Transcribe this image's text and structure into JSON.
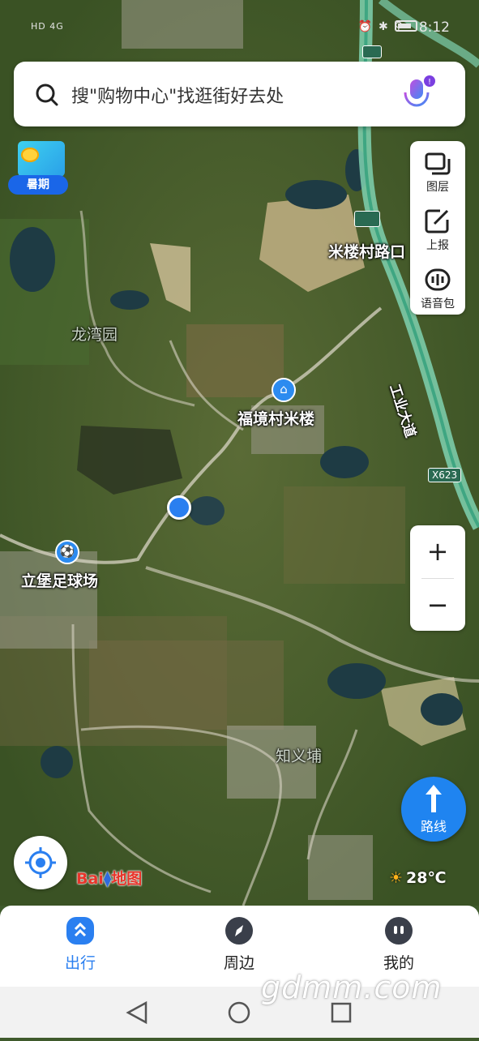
{
  "status_bar": {
    "network": "HD 4G",
    "time": "8:12"
  },
  "search": {
    "placeholder": "搜\"购物中心\"找逛街好去处"
  },
  "promo": {
    "label": "暑期"
  },
  "tools": [
    {
      "label": "图层",
      "icon": "layers-icon"
    },
    {
      "label": "上报",
      "icon": "report-edit-icon"
    },
    {
      "label": "语音包",
      "icon": "voice-pack-icon"
    }
  ],
  "map": {
    "places": [
      "米楼村路口",
      "龙湾园",
      "福境村米楼",
      "立堡足球场",
      "知义埔"
    ],
    "road_label": "工业大道",
    "road_sign": "X623"
  },
  "zoom": {
    "in": "+",
    "out": "−"
  },
  "route": {
    "label": "路线"
  },
  "logo": {
    "text_a": "Bai",
    "text_b": "地图"
  },
  "weather": {
    "temperature": "28℃"
  },
  "tabs": [
    {
      "label": "出行",
      "active": true
    },
    {
      "label": "周边",
      "active": false
    },
    {
      "label": "我的",
      "active": false
    }
  ],
  "watermark": "gdmm.com",
  "colors": {
    "accent": "#2a7ff0",
    "route": "#1f84f0"
  }
}
